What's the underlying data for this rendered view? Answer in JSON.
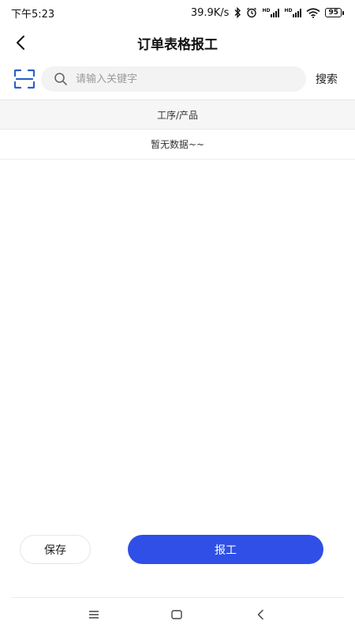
{
  "status": {
    "time": "下午5:23",
    "speed": "39.9K/s",
    "hd1": "HD",
    "hd2": "HD",
    "battery": "95"
  },
  "nav": {
    "title": "订单表格报工"
  },
  "search": {
    "placeholder": "请输入关键字",
    "value": "",
    "button_label": "搜索"
  },
  "table": {
    "header": "工序/产品",
    "empty_text": "暂无数据~~"
  },
  "actions": {
    "save_label": "保存",
    "report_label": "报工"
  },
  "colors": {
    "primary": "#2f4fe6",
    "scan_icon": "#2a62c9",
    "background": "#ffffff"
  },
  "icons": {
    "back": "back-arrow-icon",
    "scan": "scan-icon",
    "search": "search-icon",
    "bluetooth": "bluetooth-icon",
    "alarm": "alarm-icon",
    "wifi": "wifi-icon",
    "menu": "menu-icon",
    "home": "home-icon",
    "system_back": "system-back-icon"
  }
}
